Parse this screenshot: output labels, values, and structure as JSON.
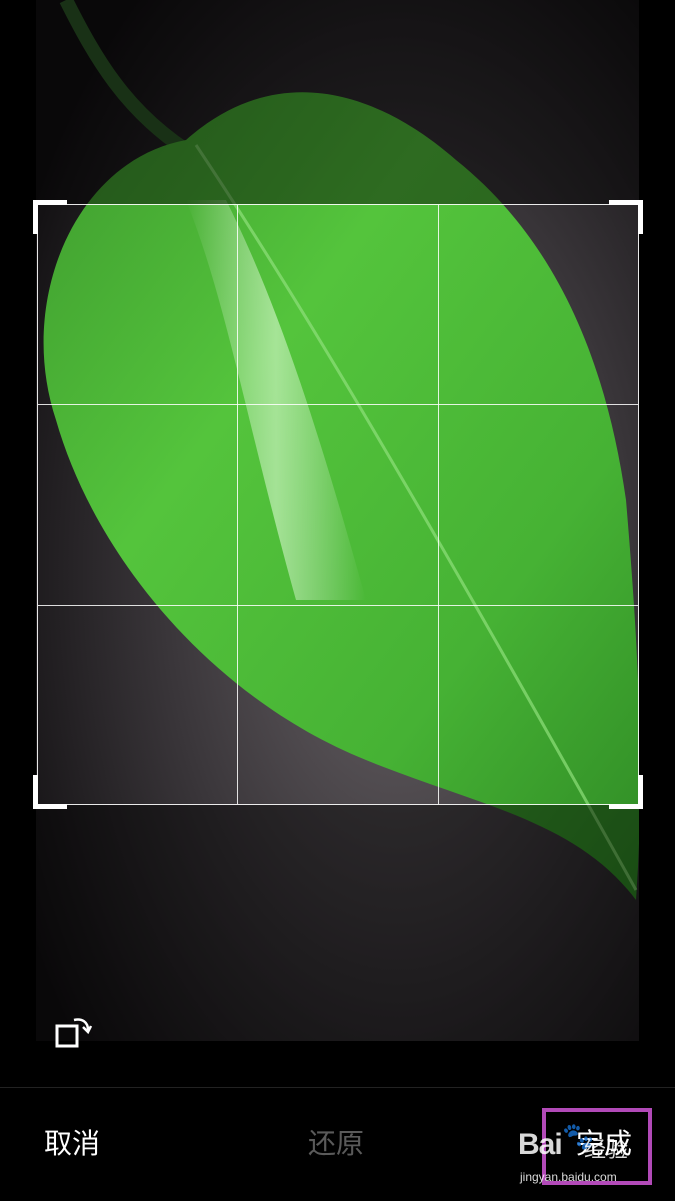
{
  "toolbar": {
    "cancel_label": "取消",
    "restore_label": "还原",
    "done_label": "完成"
  },
  "icons": {
    "rotate": "rotate-icon"
  },
  "watermark": {
    "logo": "Bai",
    "paw": "🐾",
    "cn": "经验",
    "url": "jingyan.baidu.com"
  },
  "colors": {
    "background": "#000000",
    "leaf": "#4fc23a",
    "restore_disabled": "#5a5a5a",
    "highlight": "#b24ab8"
  }
}
